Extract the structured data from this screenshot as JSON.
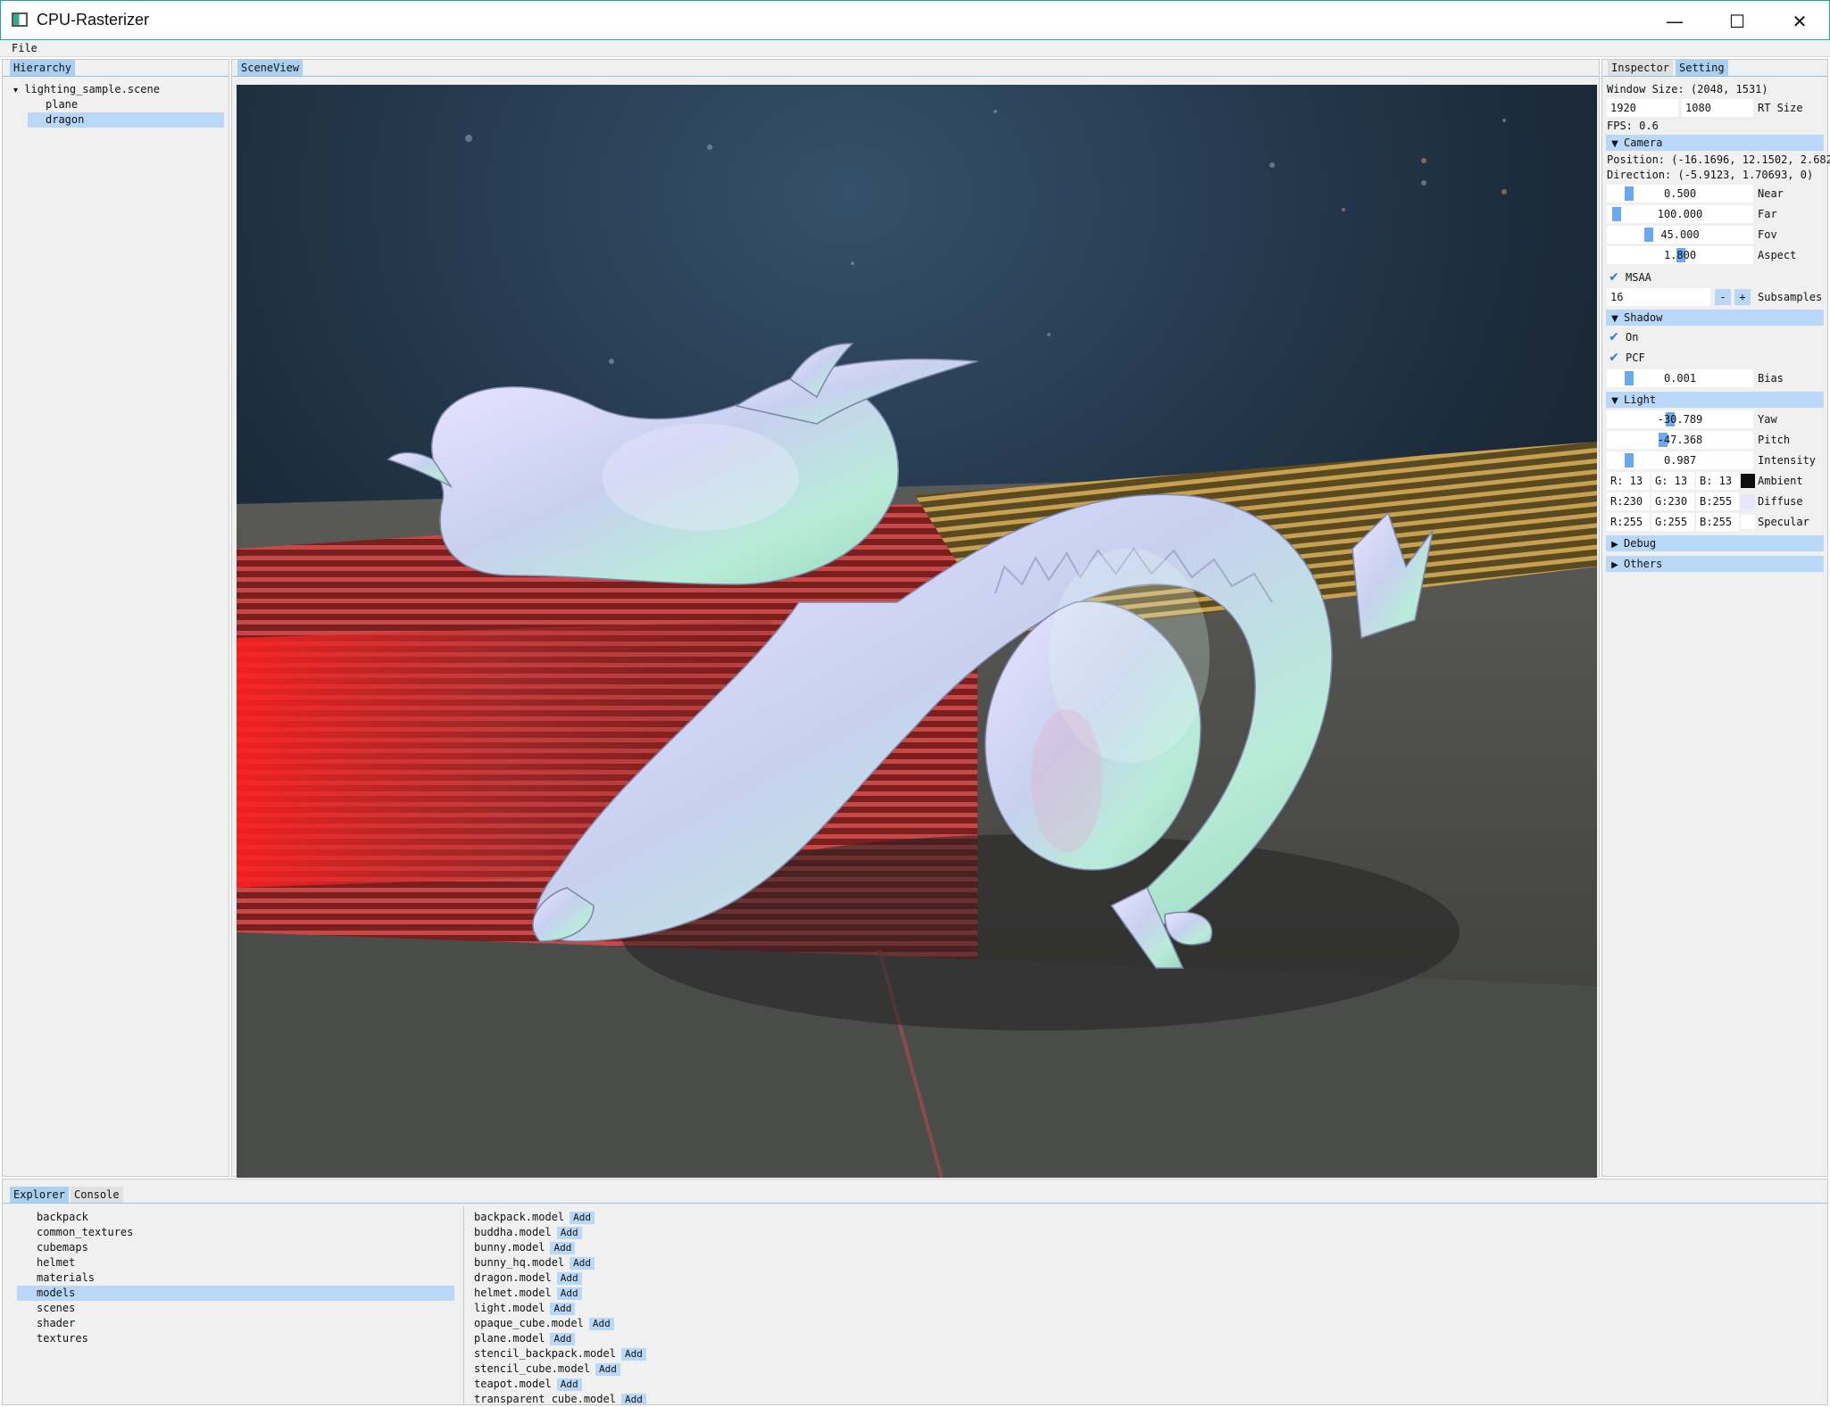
{
  "window": {
    "title": "CPU-Rasterizer",
    "minimize": "—",
    "maximize": "☐",
    "close": "✕"
  },
  "menu": {
    "file": "File"
  },
  "hierarchy": {
    "tab": "Hierarchy",
    "items": [
      {
        "arrow": "▾",
        "label": "lighting_sample.scene"
      },
      {
        "label": "plane"
      },
      {
        "label": "dragon",
        "selected": true
      }
    ]
  },
  "sceneview": {
    "tab": "SceneView"
  },
  "inspector": {
    "tabs": [
      "Inspector",
      "Setting"
    ],
    "window_size": "Window Size: (2048, 1531)",
    "rt_width": "1920",
    "rt_height": "1080",
    "rt_size_label": "RT Size",
    "fps": "FPS: 0.6",
    "camera": {
      "header": "Camera",
      "position": "Position: (-16.1696, 12.1502, 2.682",
      "direction": "Direction: (-5.9123, 1.70693, 0)",
      "near": {
        "value": "0.500",
        "label": "Near"
      },
      "far": {
        "value": "100.000",
        "label": "Far"
      },
      "fov": {
        "value": "45.000",
        "label": "Fov"
      },
      "aspect": {
        "value": "1.800",
        "label": "Aspect"
      },
      "msaa_label": "MSAA",
      "subsamples": {
        "value": "16",
        "minus": "-",
        "plus": "+",
        "label": "Subsamples"
      }
    },
    "shadow": {
      "header": "Shadow",
      "on_label": "On",
      "pcf_label": "PCF",
      "bias": {
        "value": "0.001",
        "label": "Bias"
      }
    },
    "light": {
      "header": "Light",
      "yaw": {
        "value": "-30.789",
        "label": "Yaw"
      },
      "pitch": {
        "value": "-47.368",
        "label": "Pitch"
      },
      "intensity": {
        "value": "0.987",
        "label": "Intensity"
      },
      "ambient": {
        "r": "R: 13",
        "g": "G: 13",
        "b": "B: 13",
        "label": "Ambient",
        "color": "#0d0d0d"
      },
      "diffuse": {
        "r": "R:230",
        "g": "G:230",
        "b": "B:255",
        "label": "Diffuse",
        "color": "#e6e6ff"
      },
      "specular": {
        "r": "R:255",
        "g": "G:255",
        "b": "B:255",
        "label": "Specular",
        "color": "#ffffff"
      }
    },
    "debug": {
      "header": "Debug"
    },
    "others": {
      "header": "Others"
    }
  },
  "explorer": {
    "tabs": [
      "Explorer",
      "Console"
    ],
    "folders": [
      "backpack",
      "common_textures",
      "cubemaps",
      "helmet",
      "materials",
      "models",
      "scenes",
      "shader",
      "textures"
    ],
    "selected_folder": "models",
    "add_label": "Add",
    "files": [
      "backpack.model",
      "buddha.model",
      "bunny.model",
      "bunny_hq.model",
      "dragon.model",
      "helmet.model",
      "light.model",
      "opaque_cube.model",
      "plane.model",
      "stencil_backpack.model",
      "stencil_cube.model",
      "teapot.model",
      "transparent_cube.model"
    ]
  },
  "colors": {
    "accent": "#b9d8f7",
    "tab_active": "#aacff0",
    "slider_grab": "#6aa8ef",
    "check": "#2a7bd0"
  },
  "icons": {
    "app": "app-window-icon",
    "collapse": "triangle-down-icon",
    "expand": "triangle-right-icon",
    "check": "checkmark-icon"
  }
}
